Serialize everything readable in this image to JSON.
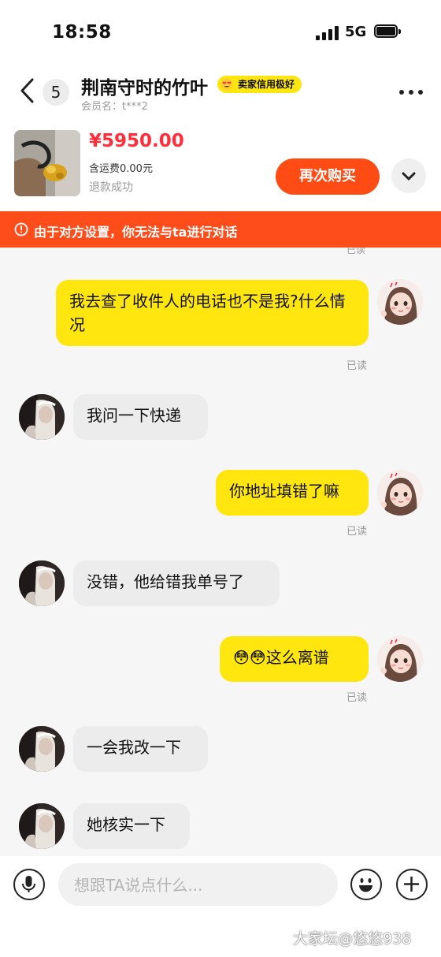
{
  "status_bar": {
    "time": "18:58",
    "network": "5G"
  },
  "header": {
    "unread_count": "5",
    "title": "荆南守时的竹叶",
    "seller_badge": "卖家信用极好",
    "member_label": "会员名：t***2"
  },
  "product": {
    "price": "¥5950.00",
    "shipping": "含运费0.00元",
    "status": "退款成功",
    "buy_again_label": "再次购买"
  },
  "notice": {
    "text": "由于对方设置，你无法与ta进行对话"
  },
  "chat": {
    "top_read_label": "已读",
    "messages": [
      {
        "from": "me",
        "text": "我去查了收件人的电话也不是我?什么情况",
        "status": "已读"
      },
      {
        "from": "other",
        "text": "我问一下快递"
      },
      {
        "from": "me",
        "text": "你地址填错了嘛",
        "status": "已读"
      },
      {
        "from": "other",
        "text": "没错，他给错我单号了"
      },
      {
        "from": "me",
        "text": "😳😳这么离谱",
        "status": "已读"
      },
      {
        "from": "other",
        "text": "一会我改一下"
      },
      {
        "from": "other",
        "text": "她核实一下"
      }
    ]
  },
  "input_bar": {
    "placeholder": "想跟TA说点什么..."
  },
  "watermark": "大家坛@悠悠938",
  "colors": {
    "accent_yellow": "#ffe60f",
    "notice_orange": "#ff4c1b",
    "price_red": "#ff2e3a",
    "buy_button": "#ff4b14"
  }
}
